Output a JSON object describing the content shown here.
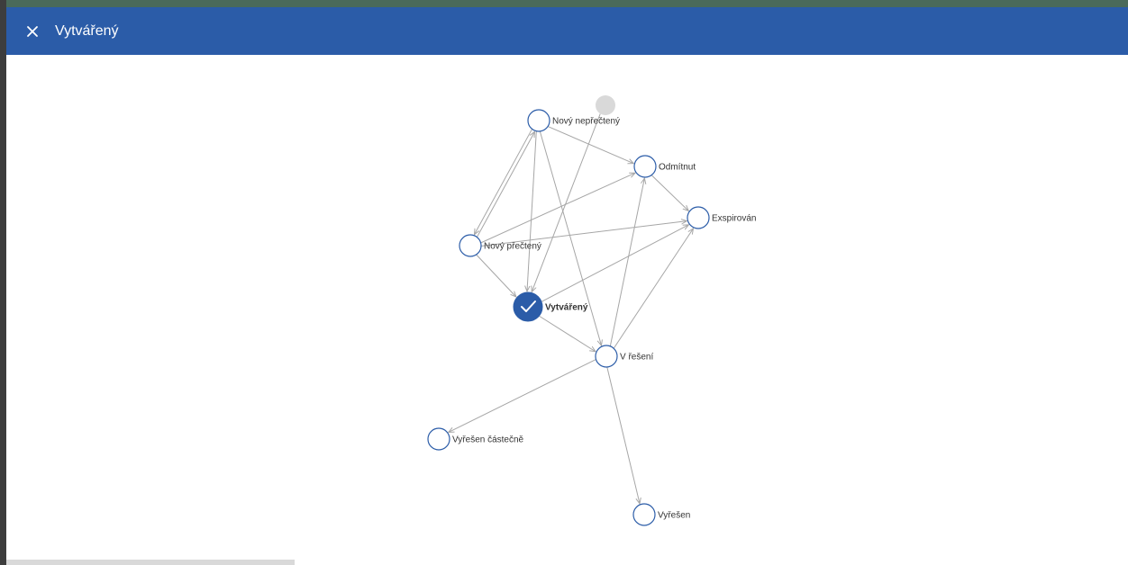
{
  "header": {
    "title": "Vytvářený",
    "close_icon": "close-icon"
  },
  "colors": {
    "header_bg": "#2b5ca8",
    "node_stroke": "#2b5ca8",
    "edge": "#a6a6a6",
    "active_fill": "#2b5ca8",
    "ghost_fill": "#d9d9d9"
  },
  "graph": {
    "current_state": "Vytvářený",
    "nodes": [
      {
        "id": "ghost",
        "label": ""
      },
      {
        "id": "novy_neprecteny",
        "label": "Nový nepřečtený"
      },
      {
        "id": "odmitnut",
        "label": "Odmítnut"
      },
      {
        "id": "exspirovan",
        "label": "Exspirován"
      },
      {
        "id": "novy_precteny",
        "label": "Nový přečtený"
      },
      {
        "id": "vytvareny",
        "label": "Vytvářený"
      },
      {
        "id": "v_reseni",
        "label": "V řešení"
      },
      {
        "id": "vyresen_castecne",
        "label": "Vyřešen částečně"
      },
      {
        "id": "vyresen",
        "label": "Vyřešen"
      }
    ],
    "edges": [
      {
        "from": "novy_neprecteny",
        "to": "odmitnut"
      },
      {
        "from": "novy_neprecteny",
        "to": "novy_precteny"
      },
      {
        "from": "novy_neprecteny",
        "to": "v_reseni"
      },
      {
        "from": "novy_neprecteny",
        "to": "vytvareny"
      },
      {
        "from": "ghost",
        "to": "vytvareny"
      },
      {
        "from": "odmitnut",
        "to": "exspirovan"
      },
      {
        "from": "novy_precteny",
        "to": "novy_neprecteny"
      },
      {
        "from": "novy_precteny",
        "to": "odmitnut"
      },
      {
        "from": "novy_precteny",
        "to": "exspirovan"
      },
      {
        "from": "novy_precteny",
        "to": "vytvareny"
      },
      {
        "from": "vytvareny",
        "to": "exspirovan"
      },
      {
        "from": "vytvareny",
        "to": "v_reseni"
      },
      {
        "from": "v_reseni",
        "to": "odmitnut"
      },
      {
        "from": "v_reseni",
        "to": "exspirovan"
      },
      {
        "from": "v_reseni",
        "to": "vyresen_castecne"
      },
      {
        "from": "v_reseni",
        "to": "vyresen"
      }
    ]
  }
}
